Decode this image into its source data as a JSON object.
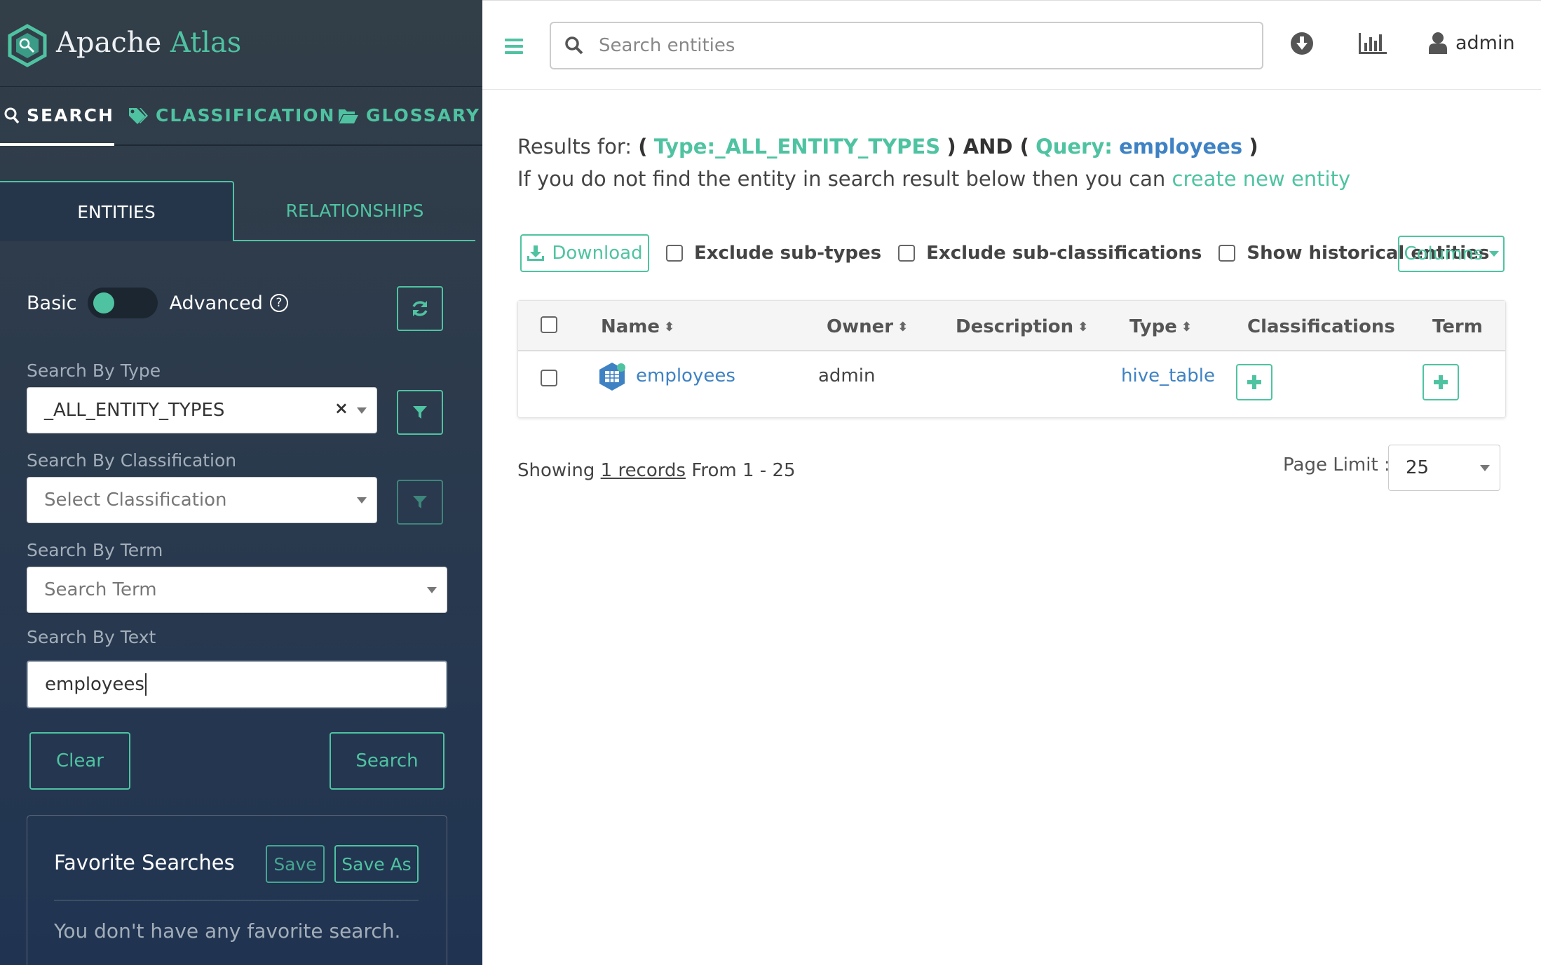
{
  "brand": {
    "name_plain": "Apache",
    "name_accent": "Atlas"
  },
  "nav_tabs": [
    {
      "label": "SEARCH",
      "icon": "search-icon"
    },
    {
      "label": "CLASSIFICATION",
      "icon": "tag-icon"
    },
    {
      "label": "GLOSSARY",
      "icon": "folder-open-icon"
    }
  ],
  "subtabs": {
    "entities": "ENTITIES",
    "relationships": "RELATIONSHIPS"
  },
  "mode": {
    "basic": "Basic",
    "advanced": "Advanced",
    "help": "?"
  },
  "filters": {
    "type_label": "Search By Type",
    "type_value": "_ALL_ENTITY_TYPES",
    "type_clear": "×",
    "classification_label": "Search By Classification",
    "classification_placeholder": "Select Classification",
    "term_label": "Search By Term",
    "term_placeholder": "Search Term",
    "text_label": "Search By Text",
    "text_value": "employees"
  },
  "actions": {
    "clear": "Clear",
    "search": "Search"
  },
  "favorites": {
    "title": "Favorite Searches",
    "save": "Save",
    "save_as": "Save As",
    "empty": "You don't have any favorite search."
  },
  "topbar": {
    "search_placeholder": "Search entities",
    "user": "admin"
  },
  "results": {
    "prefix": "Results for:",
    "open1": "(",
    "type_key": "Type:",
    "type_value": "_ALL_ENTITY_TYPES",
    "close_and": ") AND (",
    "query_key": "Query:",
    "query_value": "employees",
    "close": ")",
    "hint": "If you do not find the entity in search result below then you can",
    "hint_link": "create new entity"
  },
  "toolbar": {
    "download": "Download",
    "exclude_subtypes": "Exclude sub-types",
    "exclude_subclassifications": "Exclude sub-classifications",
    "show_historical": "Show historical entities",
    "columns": "Columns"
  },
  "table": {
    "headers": {
      "name": "Name",
      "owner": "Owner",
      "description": "Description",
      "type": "Type",
      "classifications": "Classifications",
      "term": "Term"
    },
    "rows": [
      {
        "name": "employees",
        "owner": "admin",
        "description": "",
        "type": "hive_table"
      }
    ]
  },
  "pagination": {
    "showing": "Showing",
    "records": "1 records",
    "range": "From 1 - 25",
    "page_limit_label": "Page Limit :",
    "page_limit_value": "25"
  },
  "colors": {
    "accent": "#4fc3a1",
    "link": "#3f82c4",
    "sidebar": "#2b3a4d"
  }
}
